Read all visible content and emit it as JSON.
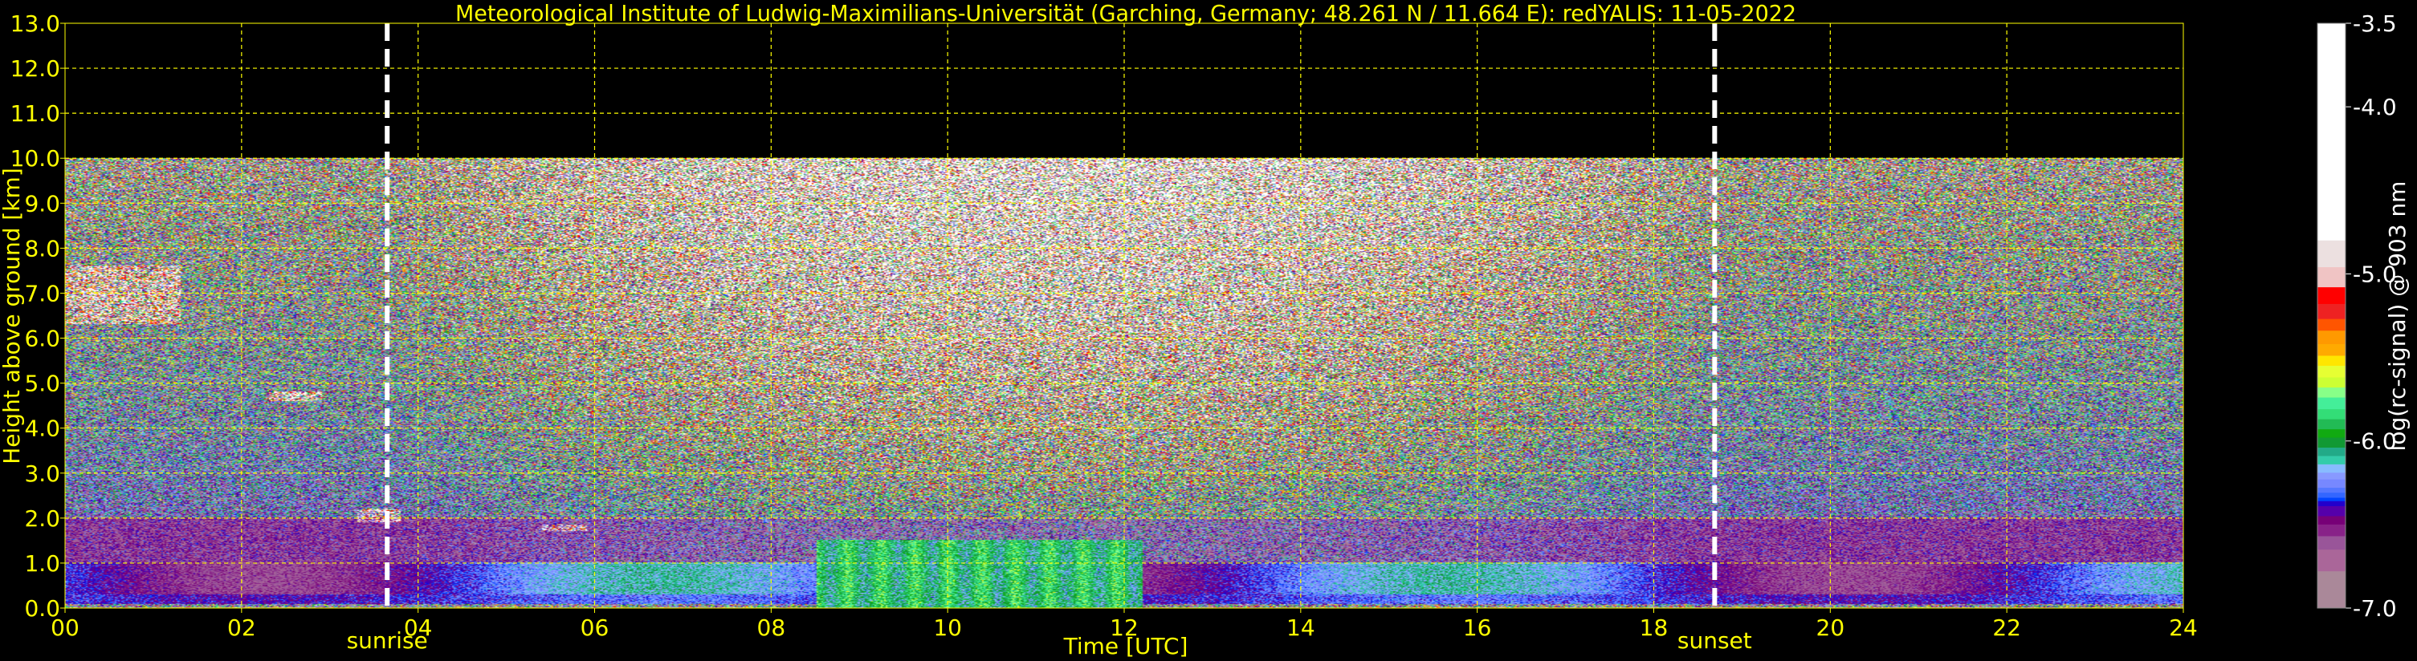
{
  "chart_data": {
    "type": "heatmap",
    "title": "Meteorological Institute of Ludwig-Maximilians-Universität (Garching, Germany; 48.261 N / 11.664 E):    redYALIS: 11-05-2022",
    "xlabel": "Time [UTC]",
    "ylabel": "Height above ground [km]",
    "xlim": [
      0,
      24
    ],
    "ylim": [
      0,
      13
    ],
    "data_top_km": 10,
    "x_ticks": [
      0,
      2,
      4,
      6,
      8,
      10,
      12,
      14,
      16,
      18,
      20,
      22,
      24
    ],
    "x_tick_labels": [
      "00",
      "02",
      "04",
      "06",
      "08",
      "10",
      "12",
      "14",
      "16",
      "18",
      "20",
      "22",
      "24"
    ],
    "y_ticks": [
      0,
      1,
      2,
      3,
      4,
      5,
      6,
      7,
      8,
      9,
      10,
      11,
      12,
      13
    ],
    "y_tick_labels": [
      "0.0",
      "1.0",
      "2.0",
      "3.0",
      "4.0",
      "5.0",
      "6.0",
      "7.0",
      "8.0",
      "9.0",
      "10.0",
      "11.0",
      "12.0",
      "13.0"
    ],
    "grid": true,
    "annotations": [
      {
        "label": "sunrise",
        "x": 3.65
      },
      {
        "label": "sunset",
        "x": 18.69
      }
    ],
    "colorbar": {
      "label": "log(rc-signal) @ 903 nm",
      "range": [
        -7.0,
        -3.5
      ],
      "ticks": [
        -3.5,
        -4.0,
        -5.0,
        -6.0,
        -7.0
      ],
      "tick_labels": [
        "-3.5",
        "-4.0",
        "-5.0",
        "-6.0",
        "-7.0"
      ],
      "bands": [
        [
          -3.5,
          -4.8,
          "#ffffff"
        ],
        [
          -4.8,
          -4.96,
          "#ece0e0"
        ],
        [
          -4.96,
          -5.08,
          "#f0c4c4"
        ],
        [
          -5.08,
          -5.18,
          "#ff0000"
        ],
        [
          -5.18,
          -5.27,
          "#ee2222"
        ],
        [
          -5.27,
          -5.34,
          "#ff5500"
        ],
        [
          -5.34,
          -5.42,
          "#ff9900"
        ],
        [
          -5.42,
          -5.49,
          "#ffaa00"
        ],
        [
          -5.49,
          -5.55,
          "#ffe600"
        ],
        [
          -5.55,
          -5.62,
          "#e6ff33"
        ],
        [
          -5.62,
          -5.68,
          "#ccff33"
        ],
        [
          -5.68,
          -5.74,
          "#88ff88"
        ],
        [
          -5.74,
          -5.81,
          "#44ee99"
        ],
        [
          -5.81,
          -5.87,
          "#33dd77"
        ],
        [
          -5.87,
          -5.93,
          "#22bb55"
        ],
        [
          -5.93,
          -5.98,
          "#11aa11"
        ],
        [
          -5.98,
          -6.04,
          "#119933"
        ],
        [
          -6.04,
          -6.09,
          "#22aa88"
        ],
        [
          -6.09,
          -6.14,
          "#33ccaa"
        ],
        [
          -6.14,
          -6.19,
          "#88bbff"
        ],
        [
          -6.19,
          -6.23,
          "#8899ff"
        ],
        [
          -6.23,
          -6.28,
          "#7788ff"
        ],
        [
          -6.28,
          -6.31,
          "#5577ff"
        ],
        [
          -6.31,
          -6.34,
          "#3366ff"
        ],
        [
          -6.34,
          -6.36,
          "#0044ff"
        ],
        [
          -6.36,
          -6.39,
          "#2200cc"
        ],
        [
          -6.39,
          -6.45,
          "#5500aa"
        ],
        [
          -6.45,
          -6.5,
          "#770077"
        ],
        [
          -6.5,
          -6.57,
          "#882288"
        ],
        [
          -6.57,
          -6.65,
          "#995599"
        ],
        [
          -6.65,
          -6.78,
          "#aa6699"
        ],
        [
          -6.78,
          -7.0,
          "#aa8899"
        ]
      ]
    },
    "features": [
      {
        "type": "cloud",
        "t": [
          0.0,
          1.3
        ],
        "h_km": [
          6.3,
          7.6
        ]
      },
      {
        "type": "cloud",
        "t": [
          2.3,
          2.9
        ],
        "h_km": [
          4.6,
          4.8
        ]
      },
      {
        "type": "cloud",
        "t": [
          3.3,
          3.8
        ],
        "h_km": [
          1.9,
          2.2
        ]
      },
      {
        "type": "cloud",
        "t": [
          5.4,
          5.9
        ],
        "h_km": [
          1.7,
          1.85
        ]
      },
      {
        "type": "boundary-layer-green",
        "t": [
          8.5,
          12.2
        ],
        "h_km": [
          0,
          1.5
        ]
      }
    ]
  }
}
